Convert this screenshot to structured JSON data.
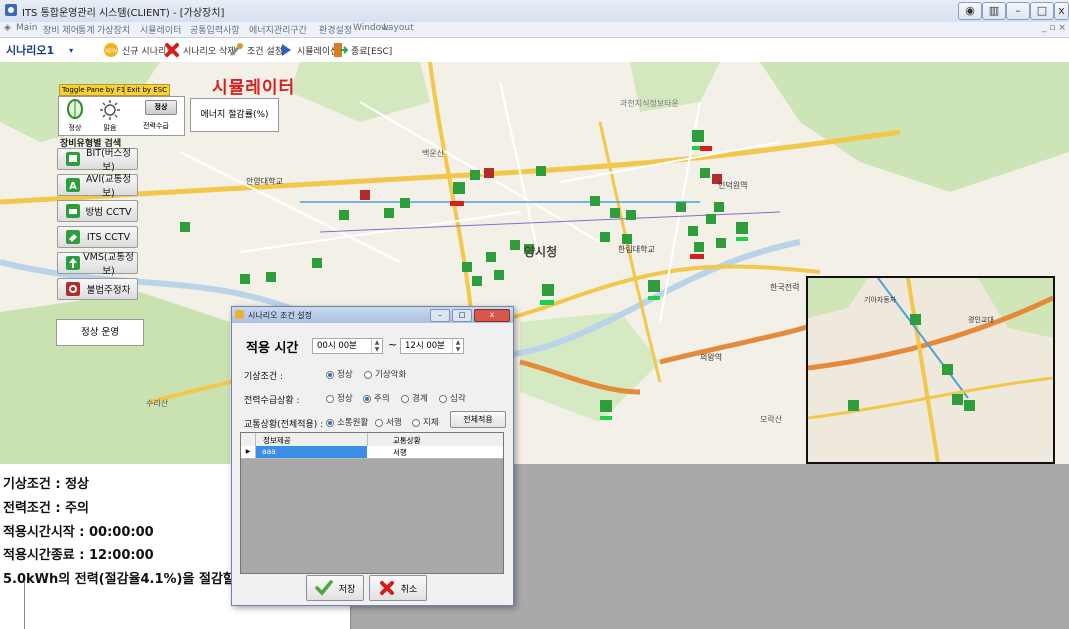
{
  "window": {
    "title": "ITS 통합운영관리 시스템(CLIENT) - [가상장치]"
  },
  "menu": [
    "Main",
    "장비 제어",
    "통계",
    "가상장치",
    "시뮬레이터",
    "공통입력사항",
    "에너지관리구간",
    "환경설정",
    "Window",
    "Layout"
  ],
  "toolbar": {
    "scenario_name": "시나리오1",
    "new_label": "신규 시나리오",
    "delete_label": "시나리오 삭제",
    "condition_label": "조건 설정",
    "simulation_label": "시뮬레이션",
    "exit_label": "종료[ESC]"
  },
  "map": {
    "simulator_title": "시뮬레이터",
    "toggle_pane": "Toggle Pane by F1",
    "exit_hint": "Exit by ESC",
    "weather_normal": "정상",
    "weather_clear": "맑음",
    "power_badge": "정상",
    "power_label": "전력수급",
    "energy_box": "에너지 절감률(%)",
    "search_title": "장비유형별 검색",
    "device_buttons": [
      "BIT(버스정보)",
      "AVI(교통정보)",
      "방범 CCTV",
      "ITS CCTV",
      "VMS(교통정보)",
      "불법주정차"
    ],
    "normal_op": "정상 운영",
    "city_label": "양시청"
  },
  "dialog": {
    "title": "시나리오 조건 설정",
    "apply_time_label": "적용 시간",
    "start_time": "00시 00분",
    "range_sep": "~",
    "end_time": "12시 00분",
    "weather_label": "기상조건 :",
    "weather_options": [
      "정상",
      "기상악화"
    ],
    "power_label": "전력수급상황 :",
    "power_options": [
      "정상",
      "주의",
      "경계",
      "심각"
    ],
    "traffic_label": "교통상황(전체적용) :",
    "traffic_options": [
      "소통원활",
      "서행",
      "지체"
    ],
    "apply_all": "전체적용",
    "grid_headers": [
      "정보제공",
      "교통상황"
    ],
    "grid_row": {
      "info": "aaa",
      "status": "서행"
    },
    "save_label": "저장",
    "cancel_label": "취소"
  },
  "status": {
    "weather": "기상조건 : 정상",
    "power": "전력조건 : 주의",
    "start": "적용시간시작 : 00:00:00",
    "end": "적용시간종료 : 12:00:00",
    "saving": "5.0kWh의 전력(절감율4.1%)을 절감할"
  },
  "colors": {
    "simulator_title": "#d42020",
    "device_green": "#2e9e3c",
    "highlight_row": "#3a8ee8"
  }
}
